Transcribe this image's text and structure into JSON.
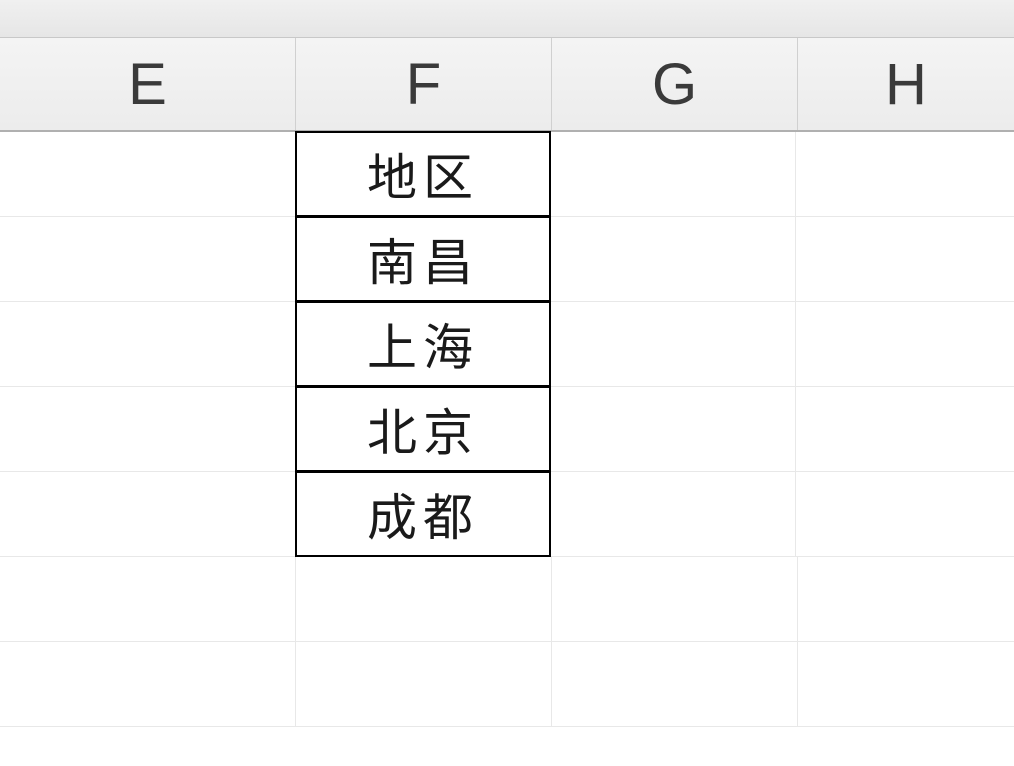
{
  "columns": {
    "E": "E",
    "F": "F",
    "G": "G",
    "H": "H"
  },
  "data": {
    "F": [
      "地区",
      "南昌",
      "上海",
      "北京",
      "成都"
    ]
  }
}
